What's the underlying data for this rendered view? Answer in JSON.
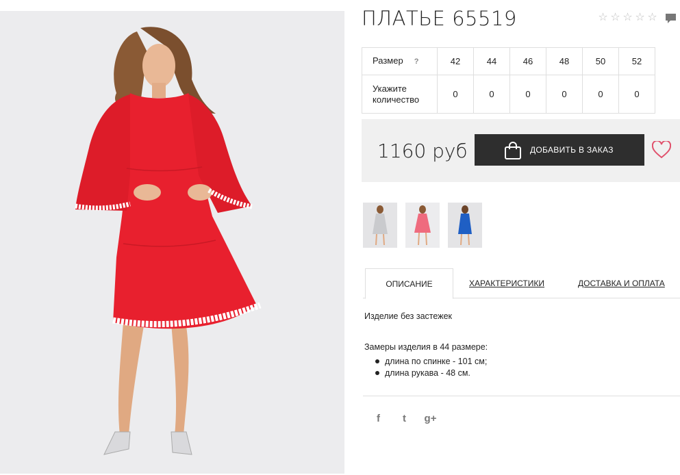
{
  "product": {
    "title": "ПЛАТЬЕ 65519",
    "rating_stars": [
      "☆",
      "☆",
      "☆",
      "☆",
      "☆"
    ],
    "price": "1160 руб",
    "add_to_cart_label": "ДОБАВИТЬ В ЗАКАЗ",
    "main_color": "#e8202e",
    "thumbnail_colors": [
      "#c9cacd",
      "#ef6b7e",
      "#1f5fc4"
    ]
  },
  "sizes": {
    "size_label": "Размер",
    "help_label": "?",
    "qty_label_line1": "Укажите",
    "qty_label_line2": "количество",
    "values": [
      "42",
      "44",
      "46",
      "48",
      "50",
      "52"
    ],
    "quantities": [
      "0",
      "0",
      "0",
      "0",
      "0",
      "0"
    ]
  },
  "tabs": {
    "description": "ОПИСАНИЕ",
    "characteristics": "ХАРАКТЕРИСТИКИ",
    "delivery": "ДОСТАВКА И ОПЛАТА"
  },
  "description": {
    "line1": "Изделие без застежек",
    "line2": "Замеры изделия в 44 размере:",
    "items": [
      "длина по спинке - 101 см;",
      "длина рукава - 48 см."
    ]
  },
  "social": {
    "facebook": "f",
    "twitter": "t",
    "google_plus": "g+"
  }
}
